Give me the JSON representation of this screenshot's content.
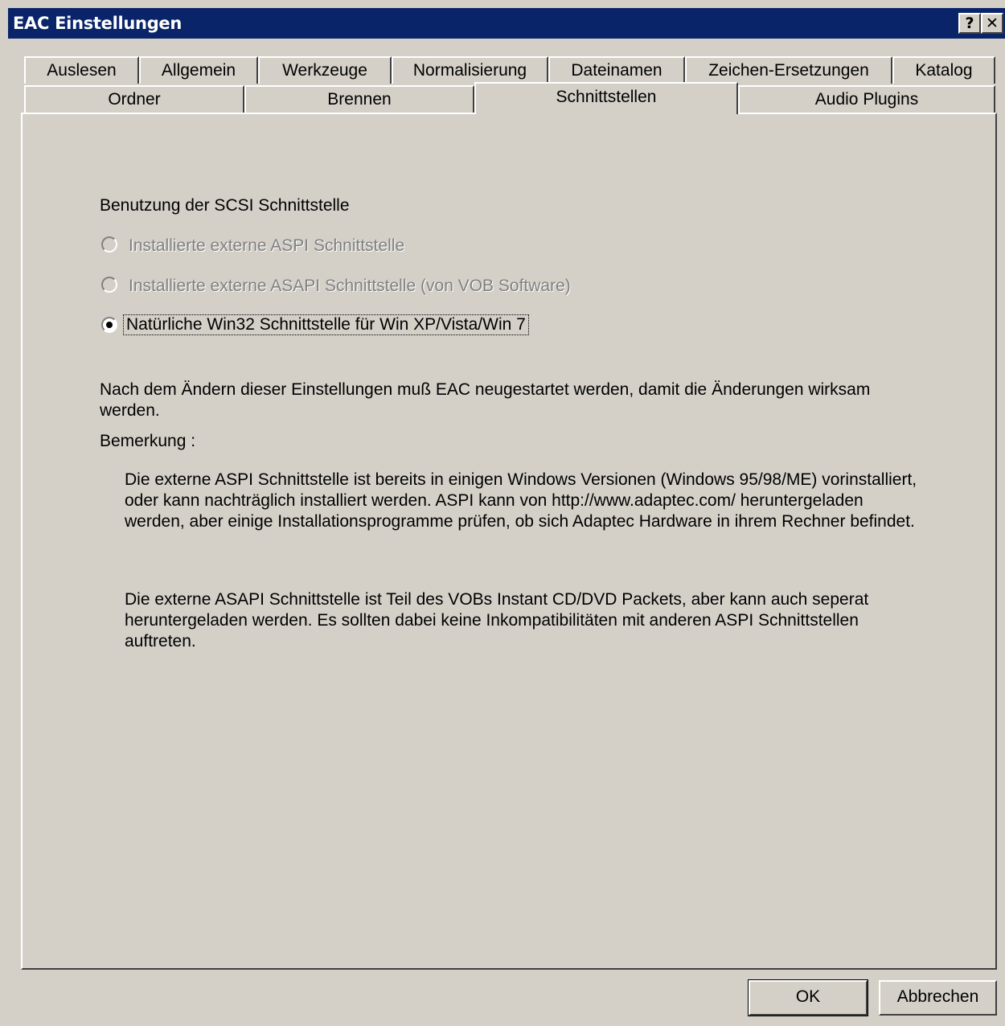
{
  "window": {
    "title": "EAC Einstellungen",
    "help_button": "?",
    "close_button": "✕"
  },
  "tabs_row1": [
    "Auslesen",
    "Allgemein",
    "Werkzeuge",
    "Normalisierung",
    "Dateinamen",
    "Zeichen-Ersetzungen",
    "Katalog"
  ],
  "tabs_row2": [
    "Ordner",
    "Brennen",
    "Schnittstellen",
    "Audio Plugins"
  ],
  "active_tab": "Schnittstellen",
  "section": {
    "heading": "Benutzung der SCSI Schnittstelle",
    "options": [
      {
        "label": "Installierte externe ASPI Schnittstelle",
        "selected": false,
        "enabled": false
      },
      {
        "label": "Installierte externe ASAPI Schnittstelle (von VOB Software)",
        "selected": false,
        "enabled": false
      },
      {
        "label": "Natürliche Win32 Schnittstelle für Win XP/Vista/Win 7",
        "selected": true,
        "enabled": true
      }
    ],
    "restart_note": "Nach dem Ändern dieser Einstellungen muß EAC neugestartet werden, damit die Änderungen wirksam werden.",
    "remark_label": "Bemerkung :",
    "remark1": "Die externe ASPI Schnittstelle ist bereits in einigen Windows Versionen (Windows 95/98/ME) vorinstalliert, oder kann nachträglich installiert werden. ASPI kann von http://www.adaptec.com/ heruntergeladen werden, aber einige Installationsprogramme prüfen, ob sich Adaptec Hardware in ihrem Rechner befindet.",
    "remark2": "Die externe ASAPI Schnittstelle ist Teil des VOBs Instant CD/DVD Packets, aber kann auch seperat heruntergeladen werden. Es sollten dabei keine Inkompatibilitäten mit anderen ASPI Schnittstellen auftreten."
  },
  "buttons": {
    "ok": "OK",
    "cancel": "Abbrechen"
  }
}
